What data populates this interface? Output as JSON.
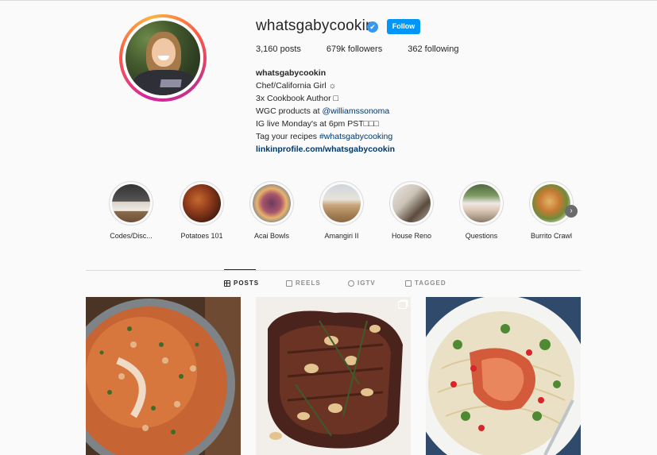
{
  "profile": {
    "username": "whatsgabycookin",
    "verified_mark": "✔",
    "follow_label": "Follow",
    "stats": {
      "posts_count": "3,160",
      "posts_word": "posts",
      "followers_count": "679k",
      "followers_word": "followers",
      "following_count": "362",
      "following_word": "following"
    },
    "bio": {
      "name": "whatsgabycookin",
      "line1": "Chef/California Girl ☼",
      "line2": "3x Cookbook Author □",
      "line3_prefix": "WGC products at ",
      "line3_link": "@williamssonoma",
      "line4": "IG live Monday's at 6pm PST□□□",
      "line5_prefix": "Tag your recipes ",
      "line5_link": "#whatsgabycooking",
      "website": "linkinprofile.com/whatsgabycookin"
    }
  },
  "highlights": [
    {
      "label": "Codes/Disc..."
    },
    {
      "label": "Potatoes 101"
    },
    {
      "label": "Acai Bowls"
    },
    {
      "label": "Amangiri II"
    },
    {
      "label": "House Reno"
    },
    {
      "label": "Questions"
    },
    {
      "label": "Burrito Crawl"
    }
  ],
  "tabs": [
    {
      "label": "POSTS",
      "icon": "grid-icon",
      "active": true
    },
    {
      "label": "REELS",
      "icon": "reels-icon",
      "active": false
    },
    {
      "label": "IGTV",
      "icon": "igtv-icon",
      "active": false
    },
    {
      "label": "TAGGED",
      "icon": "tagged-icon",
      "active": false
    }
  ],
  "posts": [
    {
      "icon": "none"
    },
    {
      "icon": "carousel-icon"
    },
    {
      "icon": "none"
    }
  ],
  "colors": {
    "follow_button": "#0095f6",
    "verified_badge": "#3897f0",
    "link": "#00376b"
  },
  "next_arrow": "›"
}
